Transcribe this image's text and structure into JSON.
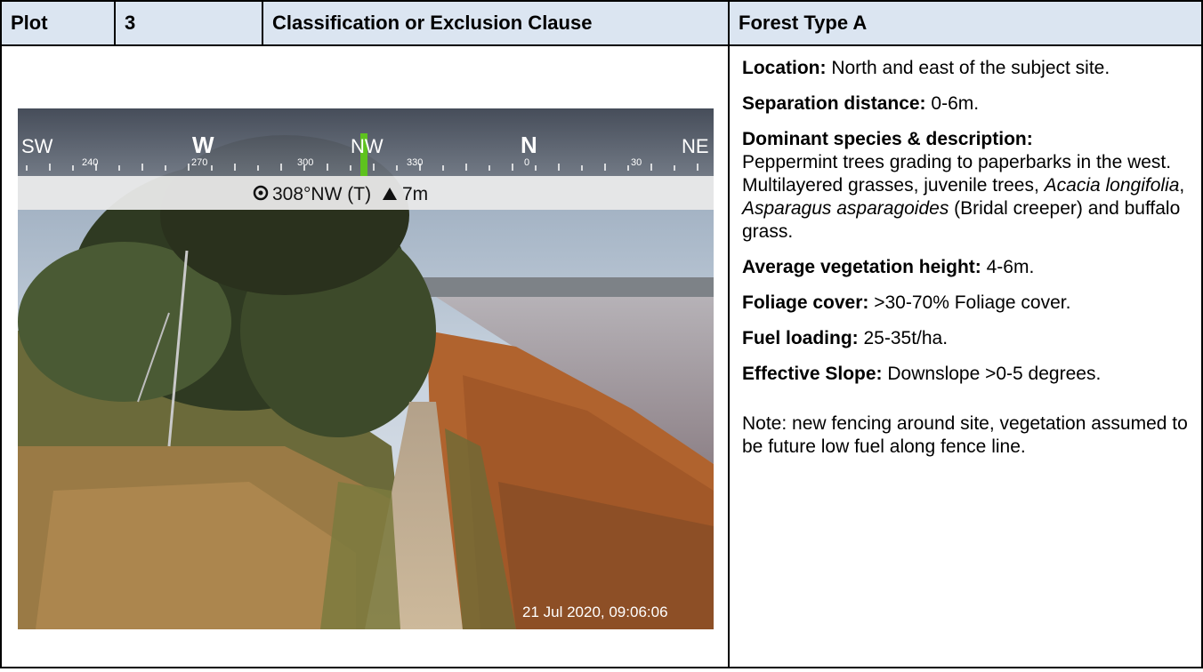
{
  "header": {
    "plot_label": "Plot",
    "plot_number": "3",
    "clause_label": "Classification or Exclusion Clause",
    "forest_type": "Forest Type A"
  },
  "details": {
    "location_label": "Location:",
    "location_value": " North and east of the subject site.",
    "separation_label": "Separation distance:",
    "separation_value": " 0-6m.",
    "species_label": "Dominant species & description:",
    "species_text_1": "Peppermint trees grading to paperbarks in the west. Multilayered grasses, juvenile trees, ",
    "species_italic_1": "Acacia longifolia",
    "species_text_2": ", ",
    "species_italic_2": "Asparagus asparagoides",
    "species_text_3": " (Bridal creeper) and buffalo grass.",
    "height_label": "Average vegetation height:",
    "height_value": " 4-6m.",
    "foliage_label": "Foliage cover:",
    "foliage_value": " >30-70% Foliage cover.",
    "fuel_label": "Fuel loading:",
    "fuel_value": " 25-35t/ha.",
    "slope_label": "Effective Slope:",
    "slope_value": " Downslope >0-5 degrees.",
    "note": "Note: new fencing around site, vegetation assumed to be future low fuel along fence line."
  },
  "photo_overlay": {
    "dir_sw": "SW",
    "dir_w": "W",
    "dir_nw": "NW",
    "dir_n": "N",
    "dir_ne": "NE",
    "tick_240": "240",
    "tick_270": "270",
    "tick_300": "300",
    "tick_330": "330",
    "tick_0": "0",
    "tick_30": "30",
    "heading": "308°NW (T)",
    "heading_icon": "compass-icon",
    "elevation": "7m",
    "elevation_icon": "triangle-up-icon",
    "timestamp": "21 Jul 2020, 09:06:06"
  }
}
